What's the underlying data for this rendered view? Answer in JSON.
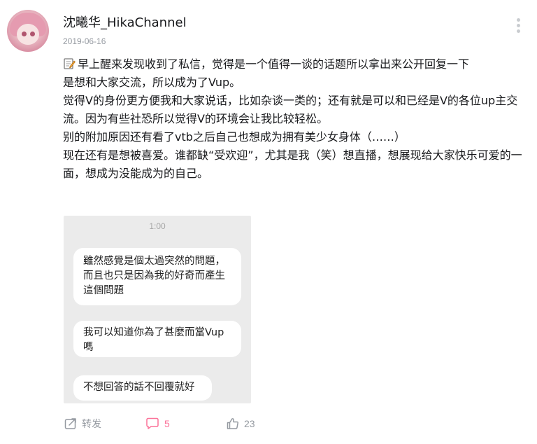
{
  "post": {
    "username": "沈曦华_HikaChannel",
    "date": "2019-06-16",
    "paragraphs": [
      "早上醒来发现收到了私信，觉得是一个值得一谈的话题所以拿出来公开回复一下",
      "是想和大家交流，所以成为了Vup。",
      "觉得V的身份更方便我和大家说话，比如杂谈一类的；还有就是可以和已经是V的各位up主交流。因为有些社恐所以觉得V的环境会让我比较轻松。",
      "别的附加原因还有看了vtb之后自己也想成为拥有美少女身体（……）",
      "现在还有是想被喜爱。谁都缺“受欢迎”，尤其是我（笑）想直播，想展现给大家快乐可爱的一面，想成为没能成为的自己。"
    ],
    "leading_icon": "memo-icon"
  },
  "image": {
    "time": "1:00",
    "messages": [
      "雖然感覺是個太過突然的問題，而且也只是因為我的好奇而產生這個問題",
      "我可以知道你為了甚麼而當Vup嗎",
      "不想回答的話不回覆就好"
    ]
  },
  "actions": {
    "forward_label": "转发",
    "comment_count": "5",
    "like_count": "23"
  },
  "colors": {
    "accent_pink": "#fb7299",
    "muted_text": "#9499a0",
    "chat_bg": "#ebebeb"
  }
}
